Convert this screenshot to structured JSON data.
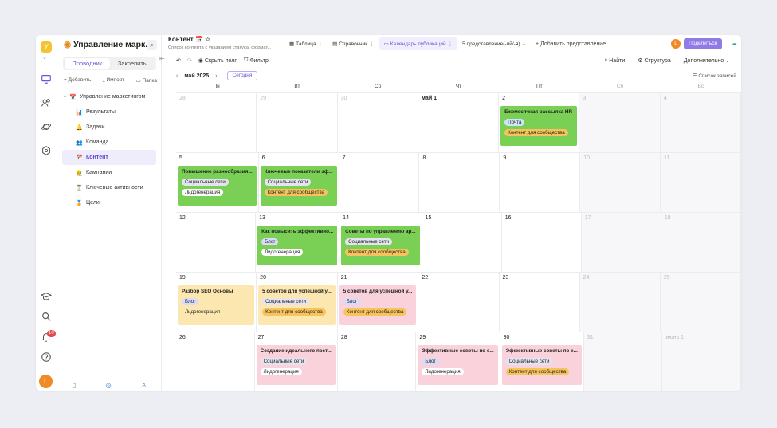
{
  "workspace": {
    "initial": "У"
  },
  "sidebar": {
    "title": "Управление марк...",
    "tabs": [
      "Проводник",
      "Закрепить"
    ],
    "actions": [
      "+ Добавить",
      "Импорт",
      "Папка"
    ],
    "root": {
      "emoji": "📅",
      "label": "Управление маркетингом"
    },
    "items": [
      {
        "emoji": "📊",
        "label": "Результаты"
      },
      {
        "emoji": "🔔",
        "label": "Задачи"
      },
      {
        "emoji": "👥",
        "label": "Команда"
      },
      {
        "emoji": "📅",
        "label": "Контент"
      },
      {
        "emoji": "👷",
        "label": "Кампании"
      },
      {
        "emoji": "⏳",
        "label": "Ключевые активности"
      },
      {
        "emoji": "🏅",
        "label": "Цели"
      }
    ]
  },
  "rail": {
    "notifications": "10",
    "avatar": "L"
  },
  "header": {
    "title": "Контент",
    "subtitle": "Список контента с указанием статуса, формат...",
    "views": [
      {
        "label": "Таблица"
      },
      {
        "label": "Справочник"
      },
      {
        "label": "Календарь публикаций"
      }
    ],
    "more_views": "5 представление(-ий/-я)",
    "add_view": "+ Добавить представление",
    "share": "Поделиться",
    "user": "L"
  },
  "toolbar": {
    "hide_fields": "Скрыть поля",
    "filter": "Фильтр",
    "find": "Найти",
    "structure": "Структура",
    "more": "Дополнительно"
  },
  "calendar": {
    "month": "май 2025",
    "today": "Сегодня",
    "list": "Список записей",
    "weekdays": [
      "Пн",
      "Вт",
      "Ср",
      "Чт",
      "Пт",
      "Сб",
      "Вс"
    ],
    "weeks": [
      [
        {
          "d": "28",
          "m": true
        },
        {
          "d": "29",
          "m": true
        },
        {
          "d": "30",
          "m": true
        },
        {
          "d": "май 1",
          "b": true
        },
        {
          "d": "2",
          "ev": {
            "title": "Ежемесячная рассылка HR",
            "color": "green",
            "tags": [
              [
                "Почта",
                "blue"
              ],
              [
                "Контент для сообщества",
                "orange"
              ]
            ]
          }
        },
        {
          "d": "3",
          "m": true
        },
        {
          "d": "4",
          "m": true
        }
      ],
      [
        {
          "d": "5",
          "ev": {
            "title": "Повышение разнообразия...",
            "color": "green",
            "tags": [
              [
                "Социальные сети",
                "gray"
              ],
              [
                "Лидогенерация",
                "white"
              ]
            ]
          }
        },
        {
          "d": "6",
          "ev": {
            "title": "Ключевые показатели эф...",
            "color": "green",
            "tags": [
              [
                "Социальные сети",
                "gray"
              ],
              [
                "Контент для сообщества",
                "orange"
              ]
            ]
          }
        },
        {
          "d": "7"
        },
        {
          "d": "8"
        },
        {
          "d": "9"
        },
        {
          "d": "10",
          "m": true
        },
        {
          "d": "11",
          "m": true
        }
      ],
      [
        {
          "d": "12"
        },
        {
          "d": "13",
          "ev": {
            "title": "Как повысить эффективно...",
            "color": "green",
            "tags": [
              [
                "Блог",
                "purple"
              ],
              [
                "Лидогенерация",
                "white"
              ]
            ]
          }
        },
        {
          "d": "14",
          "ev": {
            "title": "Советы по управлению ар...",
            "color": "green",
            "tags": [
              [
                "Социальные сети",
                "gray"
              ],
              [
                "Контент для сообщества",
                "orange"
              ]
            ]
          }
        },
        {
          "d": "15"
        },
        {
          "d": "16"
        },
        {
          "d": "17",
          "m": true
        },
        {
          "d": "18",
          "m": true
        }
      ],
      [
        {
          "d": "19",
          "ev": {
            "title": "Разбор SEO Основы",
            "color": "yellow",
            "tags": [
              [
                "Блог",
                "purple"
              ],
              [
                "Лидогенерация",
                "none"
              ]
            ]
          }
        },
        {
          "d": "20",
          "ev": {
            "title": "5 советов для успешной у...",
            "color": "yellow",
            "tags": [
              [
                "Социальные сети",
                "gray"
              ],
              [
                "Контент для сообщества",
                "orange"
              ]
            ]
          }
        },
        {
          "d": "21",
          "ev": {
            "title": "5 советов для успешной у...",
            "color": "pink",
            "tags": [
              [
                "Блог",
                "purple"
              ],
              [
                "Контент для сообщества",
                "orange"
              ]
            ]
          }
        },
        {
          "d": "22"
        },
        {
          "d": "23"
        },
        {
          "d": "24",
          "m": true
        },
        {
          "d": "25",
          "m": true
        }
      ],
      [
        {
          "d": "26"
        },
        {
          "d": "27",
          "ev": {
            "title": "Создание идеального пост...",
            "color": "pink",
            "tags": [
              [
                "Социальные сети",
                "gray"
              ],
              [
                "Лидогенерация",
                "white"
              ]
            ]
          }
        },
        {
          "d": "28"
        },
        {
          "d": "29",
          "ev": {
            "title": "Эффективные советы по е...",
            "color": "pink",
            "tags": [
              [
                "Блог",
                "purple"
              ],
              [
                "Лидогенерация",
                "white"
              ]
            ]
          }
        },
        {
          "d": "30",
          "ev": {
            "title": "Эффективные советы по е...",
            "color": "pink",
            "tags": [
              [
                "Социальные сети",
                "gray"
              ],
              [
                "Контент для сообщества",
                "orange"
              ]
            ]
          }
        },
        {
          "d": "31",
          "m": true
        },
        {
          "d": "июнь 1",
          "m": true
        }
      ]
    ]
  }
}
